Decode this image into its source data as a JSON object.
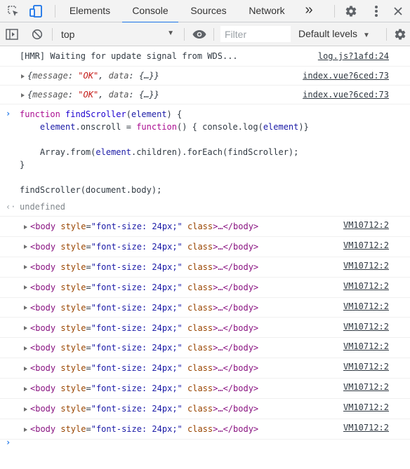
{
  "tabbar": {
    "tabs": [
      {
        "label": "Elements"
      },
      {
        "label": "Console",
        "active": true
      },
      {
        "label": "Sources"
      },
      {
        "label": "Network"
      }
    ],
    "more_label": "»"
  },
  "toolbar": {
    "context": "top",
    "filter_placeholder": "Filter",
    "levels_label": "Default levels"
  },
  "messages": {
    "hmr": {
      "text": "[HMR] Waiting for update signal from WDS...",
      "source": "log.js?1afd:24"
    },
    "obj": [
      {
        "k1": "message",
        "v1": "\"OK\"",
        "k2": "data",
        "v2": "{…}",
        "source": "index.vue?6ced:73"
      },
      {
        "k1": "message",
        "v1": "\"OK\"",
        "k2": "data",
        "v2": "{…}",
        "source": "index.vue?6ced:73"
      }
    ],
    "code": {
      "line1_kw": "function",
      "line1_name": "findScroller",
      "line1_param": "element",
      "line2_obj": "element",
      "line2_prop": ".onscroll = ",
      "line2_kw": "function",
      "line2_rest": "() { console.log(",
      "line2_arg": "element",
      "line2_end": ")}",
      "line4_a": "Array.from(",
      "line4_b": "element",
      "line4_c": ".children).forEach(findScroller);",
      "line5": "}",
      "line7": "findScroller(document.body);"
    },
    "result": "undefined",
    "body_logs": {
      "tag_open": "<body",
      "attr_name": "style",
      "attr_value": "\"font-size: 24px;\"",
      "attr2": "class",
      "ellipsis": ">…</body>",
      "source": "VM10712:2",
      "count": 11
    }
  },
  "colors": {
    "accent": "#1a73e8",
    "keyword": "#aa0d91",
    "string": "#c41a16"
  }
}
